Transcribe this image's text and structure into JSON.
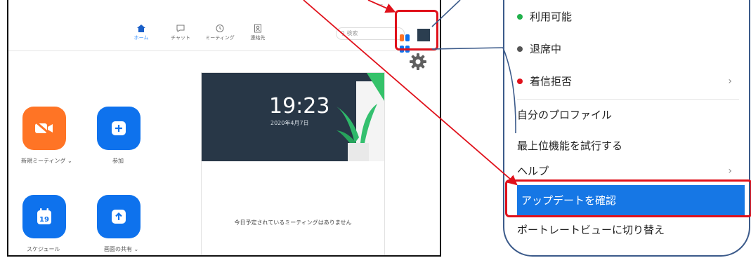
{
  "window": {
    "minimize_glyph": "—",
    "nav_tabs": [
      {
        "label": "ホーム",
        "icon": "home-icon",
        "active": true
      },
      {
        "label": "チャット",
        "icon": "chat-icon",
        "active": false
      },
      {
        "label": "ミーティング",
        "icon": "clock-icon",
        "active": false
      },
      {
        "label": "連絡先",
        "icon": "contacts-icon",
        "active": false
      }
    ],
    "search_placeholder": "検索",
    "actions": [
      {
        "label": "新規ミーティング ⌄",
        "icon": "video-off-icon",
        "color": "#ff7425"
      },
      {
        "label": "参加",
        "icon": "plus-icon",
        "color": "#0e72ed"
      },
      {
        "label": "スケジュール",
        "icon": "calendar-icon",
        "color": "#0e72ed"
      },
      {
        "label": "画面の共有 ⌄",
        "icon": "share-screen-icon",
        "color": "#0e72ed"
      }
    ],
    "calendar_day": "19",
    "clock_time": "19:23",
    "clock_date": "2020年4月7日",
    "no_meetings": "今日予定されているミーティングはありません"
  },
  "menu": {
    "status_available": "利用可能",
    "status_away": "退席中",
    "status_dnd": "着信拒否",
    "profile": "自分のプロファイル",
    "try_top_features": "最上位機能を試行する",
    "help": "ヘルプ",
    "check_updates": "アップデートを確認",
    "portrait_view": "ポートレートビューに切り替え",
    "chevron": "›"
  },
  "colors": {
    "accent": "#1677e5",
    "highlight_red": "#e0111b",
    "available": "#22b14c",
    "away": "#555555",
    "dnd": "#e0111b",
    "card_bg": "#283747"
  }
}
